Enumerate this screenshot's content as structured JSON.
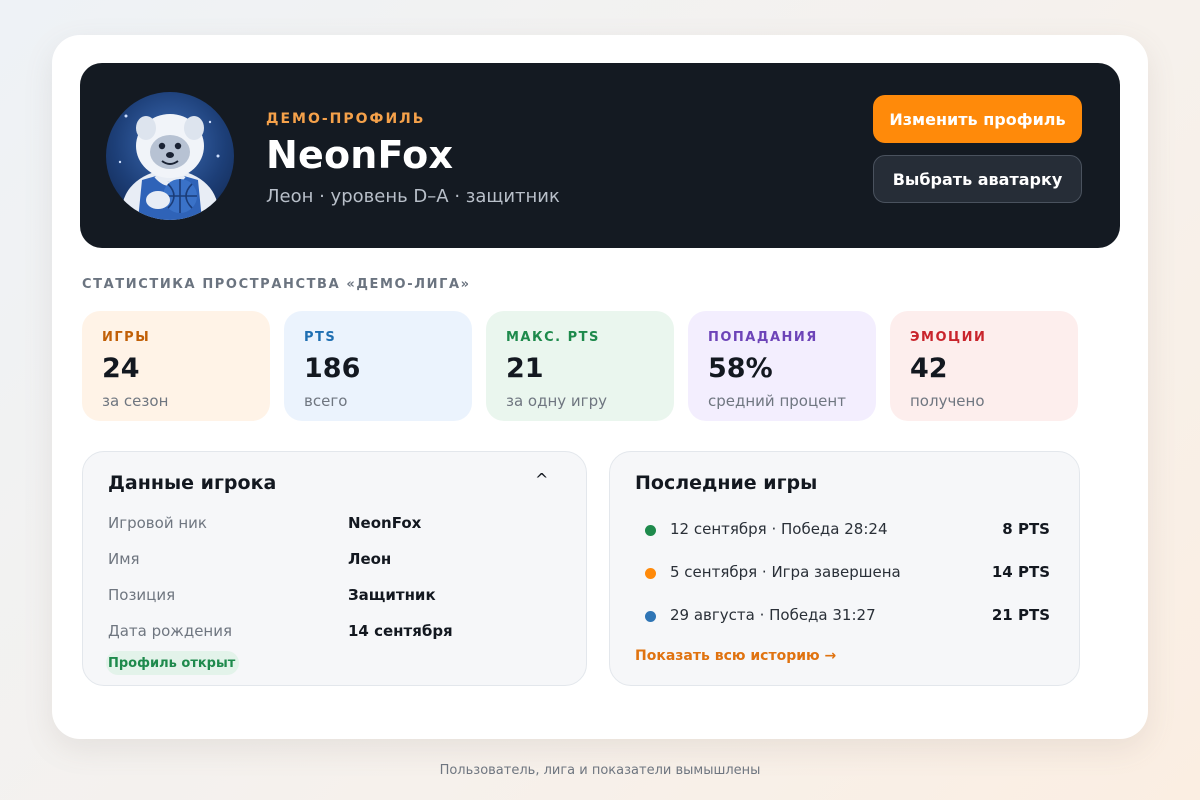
{
  "profile": {
    "eyebrow": "ДЕМО-ПРОФИЛЬ",
    "nickname": "NeonFox",
    "subtitle": "Леон · уровень D–A · защитник",
    "avatar_icon": "yeti-basketball-avatar",
    "edit_button": "Изменить профиль",
    "avatar_button": "Выбрать аватарку"
  },
  "stats": {
    "section_title": "СТАТИСТИКА ПРОСТРАНСТВА «ДЕМО-ЛИГА»",
    "cards": [
      {
        "label": "ИГРЫ",
        "value": "24",
        "caption": "за сезон",
        "color": "#c15f06",
        "bg": "#fff3e7"
      },
      {
        "label": "PTS",
        "value": "186",
        "caption": "всего",
        "color": "#1f6fb2",
        "bg": "#ebf3fd"
      },
      {
        "label": "МАКС. PTS",
        "value": "21",
        "caption": "за одну игру",
        "color": "#1e8a4c",
        "bg": "#eaf6ee"
      },
      {
        "label": "ПОПАДАНИЯ",
        "value": "58%",
        "caption": "средний процент",
        "color": "#6d44b8",
        "bg": "#f3eefe"
      },
      {
        "label": "ЭМОЦИИ",
        "value": "42",
        "caption": "получено",
        "color": "#c9242c",
        "bg": "#fdeeed"
      }
    ]
  },
  "player": {
    "title": "Данные игрока",
    "collapse_glyph": "^",
    "rows": [
      {
        "key": "Игровой ник",
        "value": "NeonFox"
      },
      {
        "key": "Имя",
        "value": "Леон"
      },
      {
        "key": "Позиция",
        "value": "Защитник"
      },
      {
        "key": "Дата рождения",
        "value": "14 сентября"
      }
    ],
    "badge": "Профиль открыт"
  },
  "games": {
    "title": "Последние игры",
    "items": [
      {
        "text": "12 сентября · Победа 28:24",
        "pts": "8 PTS",
        "color": "#1e8a4c"
      },
      {
        "text": "5 сентября · Игра завершена",
        "pts": "14 PTS",
        "color": "#ff8a0a"
      },
      {
        "text": "29 августа · Победа 31:27",
        "pts": "21 PTS",
        "color": "#2f75b5"
      }
    ],
    "history_link": "Показать всю историю →"
  },
  "footnote": "Пользователь, лига и показатели вымышлены"
}
